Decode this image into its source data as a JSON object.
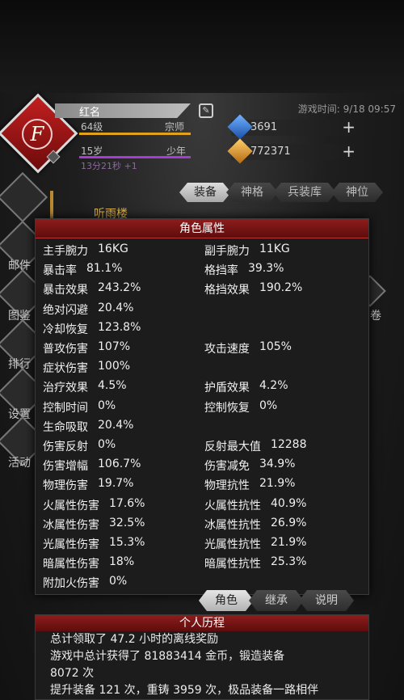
{
  "header": {
    "game_time_label": "游戏时间: 9/18 09:57",
    "avatar_glyph": "F"
  },
  "player": {
    "name": "红名",
    "level_label": "64级",
    "rank": "宗师",
    "age_label": "15岁",
    "age_rank": "少年",
    "timer": "13分21秒 +1"
  },
  "resources": {
    "blue_gem": "3691",
    "gold_gem": "772371"
  },
  "top_tabs": [
    "装备",
    "神格",
    "兵装库",
    "神位"
  ],
  "location": "听雨楼",
  "side_menu": [
    "邮件",
    "图鉴",
    "排行",
    "设置",
    "活动"
  ],
  "right_menu": "卷",
  "dialog": {
    "title": "角色属性",
    "stats": [
      [
        [
          "主手腕力",
          "16KG"
        ],
        [
          "副手腕力",
          "11KG"
        ]
      ],
      [
        [
          "暴击率",
          "81.1%"
        ],
        [
          "格挡率",
          "39.3%"
        ]
      ],
      [
        [
          "暴击效果",
          "243.2%"
        ],
        [
          "格挡效果",
          "190.2%"
        ]
      ],
      [
        [
          "绝对闪避",
          "20.4%"
        ],
        null
      ],
      [
        [
          "冷却恢复",
          "123.8%"
        ],
        null
      ],
      [
        [
          "普攻伤害",
          "107%"
        ],
        [
          "攻击速度",
          "105%"
        ]
      ],
      [
        [
          "症状伤害",
          "100%"
        ],
        null
      ],
      [
        [
          "治疗效果",
          "4.5%"
        ],
        [
          "护盾效果",
          "4.2%"
        ]
      ],
      [
        [
          "控制时间",
          "0%"
        ],
        [
          "控制恢复",
          "0%"
        ]
      ],
      [
        [
          "生命吸取",
          "20.4%"
        ],
        null
      ],
      [
        [
          "伤害反射",
          "0%"
        ],
        [
          "反射最大值",
          "12288"
        ]
      ],
      [
        [
          "伤害增幅",
          "106.7%"
        ],
        [
          "伤害减免",
          "34.9%"
        ]
      ],
      [
        [
          "物理伤害",
          "19.7%"
        ],
        [
          "物理抗性",
          "21.9%"
        ]
      ],
      [
        [
          "火属性伤害",
          "17.6%"
        ],
        [
          "火属性抗性",
          "40.9%"
        ]
      ],
      [
        [
          "冰属性伤害",
          "32.5%"
        ],
        [
          "冰属性抗性",
          "26.9%"
        ]
      ],
      [
        [
          "光属性伤害",
          "15.3%"
        ],
        [
          "光属性抗性",
          "21.9%"
        ]
      ],
      [
        [
          "暗属性伤害",
          "18%"
        ],
        [
          "暗属性抗性",
          "25.3%"
        ]
      ],
      [
        [
          "附加火伤害",
          "0%"
        ],
        null
      ]
    ],
    "tabs": [
      "角色",
      "继承",
      "说明"
    ]
  },
  "history": {
    "title": "个人历程",
    "lines": [
      "总计领取了 47.2 小时的离线奖励",
      "游戏中总计获得了 81883414 金币，锻造装备",
      "8072 次",
      "提升装备 121 次，重铸 3959 次，极品装备一路相伴"
    ]
  }
}
